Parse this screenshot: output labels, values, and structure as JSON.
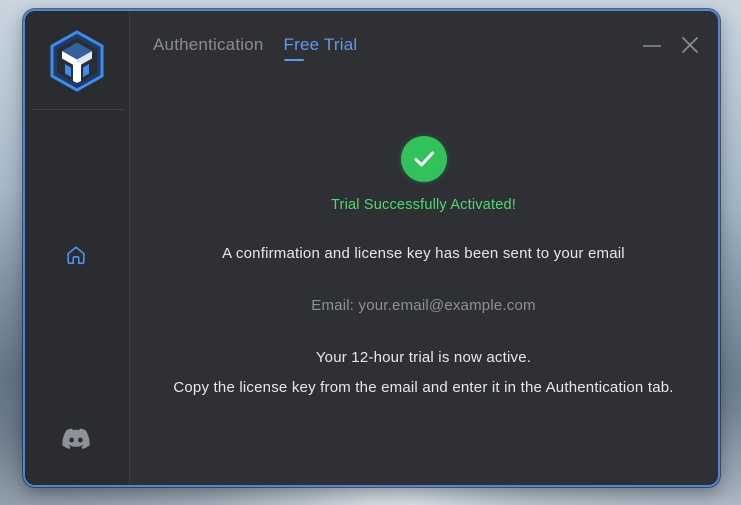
{
  "tabs": {
    "authentication": "Authentication",
    "free_trial": "Free Trial",
    "active": "free_trial"
  },
  "icons": {
    "logo": "app-logo-icon",
    "home": "home-icon",
    "discord": "discord-icon",
    "minimize": "minimize-icon",
    "close": "close-icon",
    "success": "checkmark-icon"
  },
  "colors": {
    "accent": "#5a9bf0",
    "success": "#32c25c",
    "success_text": "#4cdc6f",
    "window_bg": "#2e3034",
    "border": "#4f86d8"
  },
  "main": {
    "success_title": "Trial Successfully Activated!",
    "confirmation": "A confirmation and license key has been sent to your email",
    "email": "Email: your.email@example.com",
    "trial_status": "Your 12-hour trial is now active.",
    "instruction": "Copy the license key from the email and enter it in the Authentication tab."
  }
}
